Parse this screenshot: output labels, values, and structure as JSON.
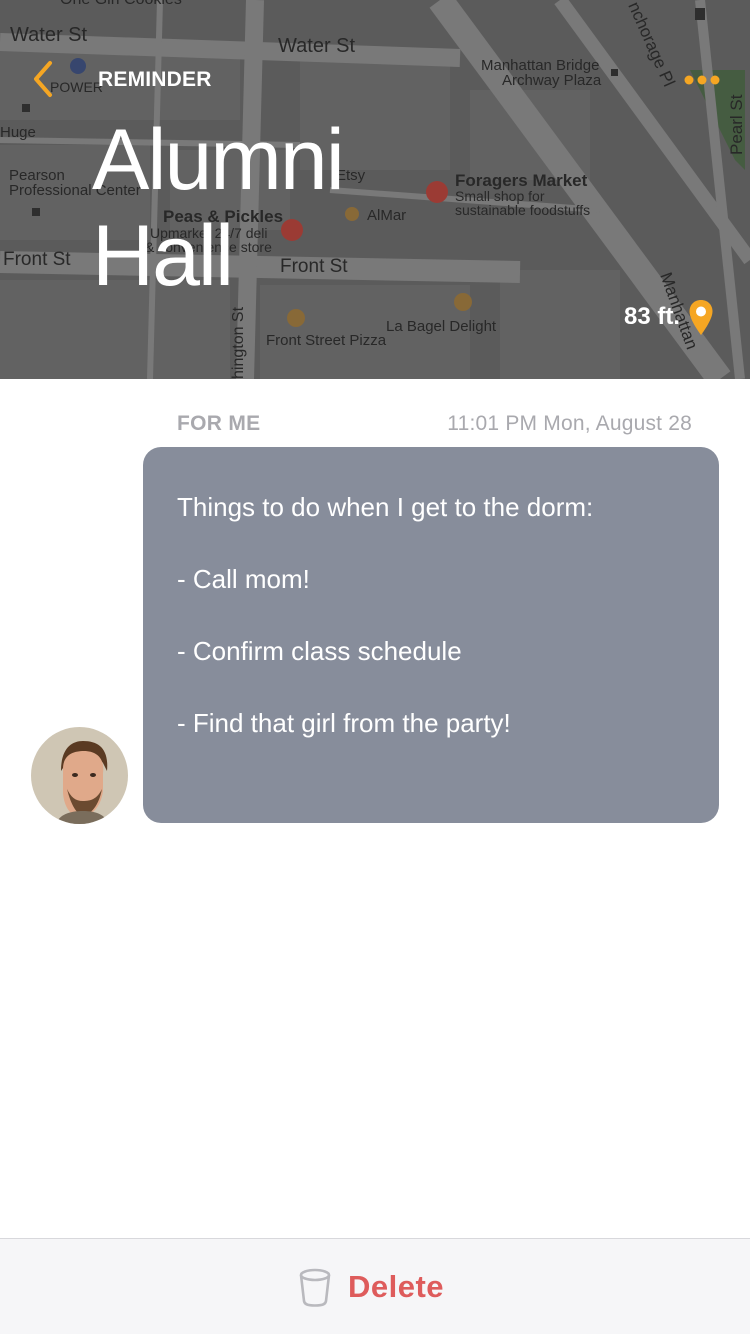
{
  "header": {
    "back_label": "REMINDER",
    "title_line1": "Alumni",
    "title_line2": "Hall",
    "distance": "83 ft.",
    "icons": {
      "back": "chevron-left-icon",
      "more": "more-dots-icon",
      "location": "location-pin-icon"
    }
  },
  "map": {
    "labels": {
      "water_st_left": "Water St",
      "water_st_right": "Water St",
      "manhattan_bridge": "Manhattan Bridge",
      "archway_plaza": "Archway Plaza",
      "anchorage_pl": "nchorage Pl",
      "pearl_st": "Pearl St",
      "power": "POWER",
      "huge": "Huge",
      "pearson_1": "Pearson",
      "pearson_2": "Professional Center",
      "etsy": "Etsy",
      "foragers_1": "Foragers Market",
      "foragers_2": "Small shop for",
      "foragers_3": "sustainable foodstuffs",
      "peas_1": "Peas & Pickles",
      "peas_2": "Upmarket 24/7 deli",
      "peas_3": "& convenience store",
      "almar": "AlMar",
      "front_st_left": "Front St",
      "front_st_right": "Front St",
      "washington_st": "hington St",
      "manhattan": "Manhattan",
      "bagel": "La Bagel Delight",
      "pizza": "Front Street Pizza",
      "top_cut": "One Girl Cookies"
    }
  },
  "message": {
    "recipient": "FOR ME",
    "timestamp": "11:01 PM Mon, August 28",
    "lines": [
      "Things to do when I get to the dorm:",
      "- Call mom!",
      "- Confirm class schedule",
      "- Find that girl from the party!"
    ]
  },
  "footer": {
    "delete_label": "Delete",
    "icon": "trash-icon"
  },
  "colors": {
    "accent": "#f5a623",
    "bubble": "#878d9b",
    "delete": "#de5c5c",
    "muted_text": "#a9a9ae"
  }
}
